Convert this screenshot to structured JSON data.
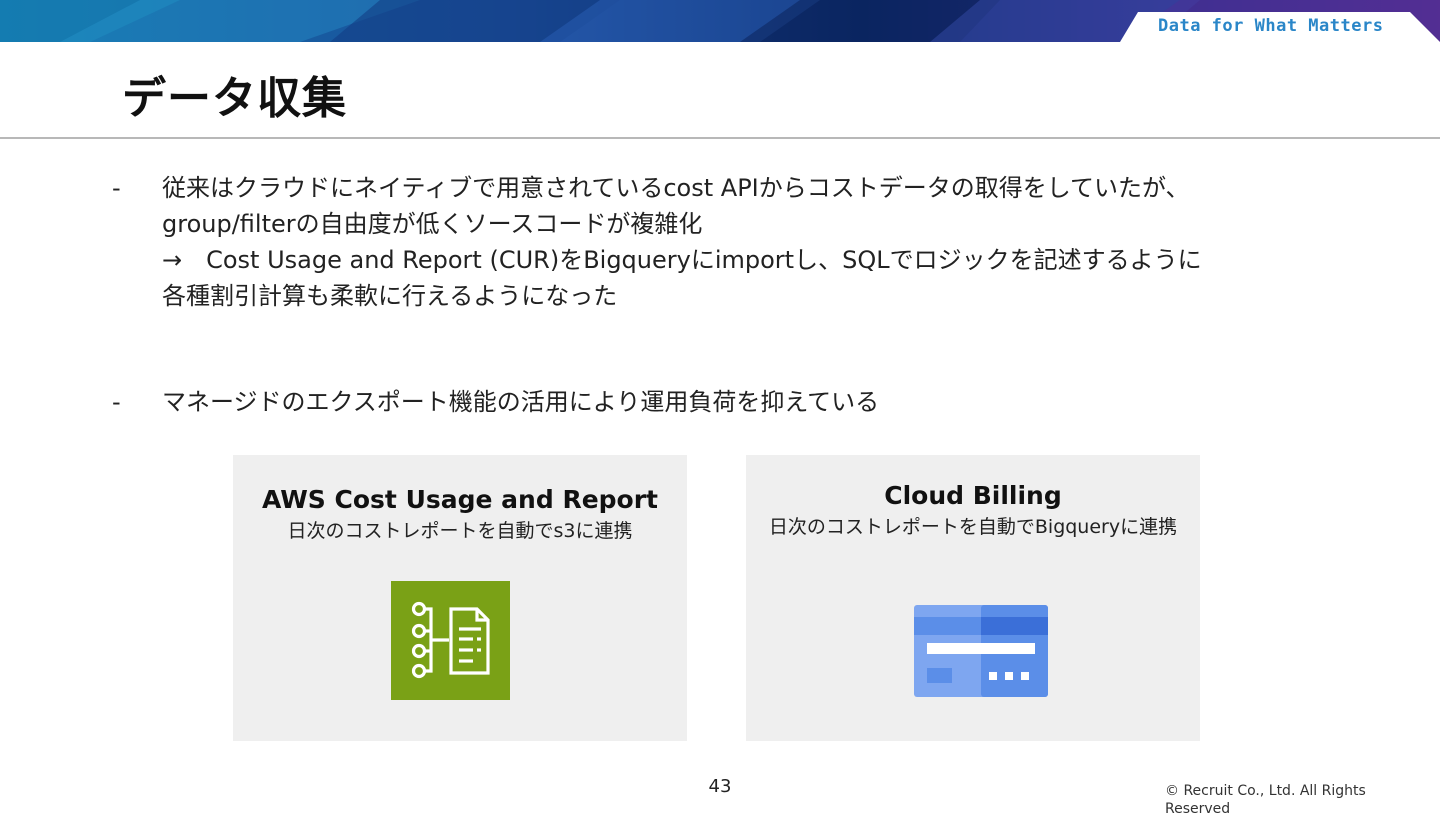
{
  "header": {
    "tagline": "Data for What Matters",
    "title": "データ収集"
  },
  "bullets": [
    {
      "marker": "-",
      "lines": [
        "従来はクラウドにネイティブで用意されているcost APIからコストデータの取得をしていたが、",
        "group/filterの自由度が低くソースコードが複雑化",
        "→　Cost Usage and Report (CUR)をBigqueryにimportし、SQLでロジックを記述するように",
        "各種割引計算も柔軟に行えるようになった"
      ]
    },
    {
      "marker": "-",
      "lines": [
        "マネージドのエクスポート機能の活用により運用負荷を抑えている"
      ]
    }
  ],
  "cards": [
    {
      "title": "AWS Cost Usage and Report",
      "subtitle": "日次のコストレポートを自動でs3に連携",
      "icon": "aws-cost-usage-report-icon",
      "icon_color": "#7aa116"
    },
    {
      "title": "Cloud Billing",
      "subtitle": "日次のコストレポートを自動でBigqueryに連携",
      "icon": "cloud-billing-card-icon",
      "icon_color": "#4a80e8"
    }
  ],
  "footer": {
    "page_number": "43",
    "copyright": "© Recruit Co., Ltd. All Rights Reserved"
  },
  "colors": {
    "banner_dark": "#0b2a6b",
    "banner_mid": "#1d5fb0",
    "banner_light": "#4aa3d8",
    "tag_text": "#2a86c8",
    "card_bg": "#efefef"
  }
}
